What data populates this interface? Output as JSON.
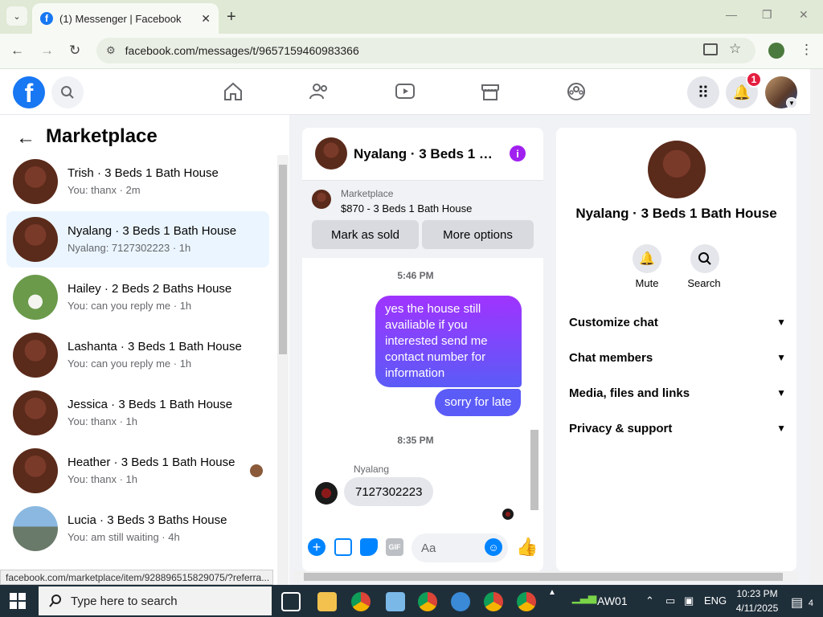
{
  "browser": {
    "tab_title": "(1) Messenger | Facebook",
    "url": "facebook.com/messages/t/9657159460983366",
    "status_url": "facebook.com/marketplace/item/928896515829075/?referra..."
  },
  "fb": {
    "notification_count": "1",
    "brand_color": "#1877f2"
  },
  "left": {
    "title": "Marketplace",
    "conversations": [
      {
        "name": "Trish · 3 Beds 1 Bath House",
        "sub": "You: thanx · 2m"
      },
      {
        "name": "Nyalang · 3 Beds 1 Bath House",
        "sub": "Nyalang: 7127302223 · 1h"
      },
      {
        "name": "Hailey · 2 Beds 2 Baths House",
        "sub": "You: can you reply me · 1h"
      },
      {
        "name": "Lashanta · 3 Beds 1 Bath House",
        "sub": "You: can you reply me · 1h"
      },
      {
        "name": "Jessica · 3 Beds 1 Bath House",
        "sub": "You: thanx · 1h"
      },
      {
        "name": "Heather · 3 Beds 1 Bath House",
        "sub": "You: thanx · 1h"
      },
      {
        "name": "Lucia · 3 Beds 3 Baths House",
        "sub": "You: am still waiting · 4h"
      }
    ]
  },
  "chat": {
    "title": "Nyalang · 3 Beds 1 B...",
    "banner_label": "Marketplace",
    "banner_price": "$870 - 3 Beds 1 Bath House",
    "mark_sold": "Mark as sold",
    "more_options": "More options",
    "time1": "5:46 PM",
    "msg1": "yes the house still availiable if you interested send me contact number for information",
    "msg2": "sorry for late",
    "time2": "8:35 PM",
    "sender": "Nyalang",
    "reply": "7127302223",
    "input_placeholder": "Aa"
  },
  "right": {
    "title": "Nyalang · 3 Beds 1 Bath House",
    "mute": "Mute",
    "search": "Search",
    "rows": [
      "Customize chat",
      "Chat members",
      "Media, files and links",
      "Privacy & support"
    ]
  },
  "taskbar": {
    "search_placeholder": "Type here to search",
    "tray_label": "AW01",
    "lang": "ENG",
    "time": "10:23 PM",
    "date": "4/11/2025",
    "notif": "4"
  }
}
